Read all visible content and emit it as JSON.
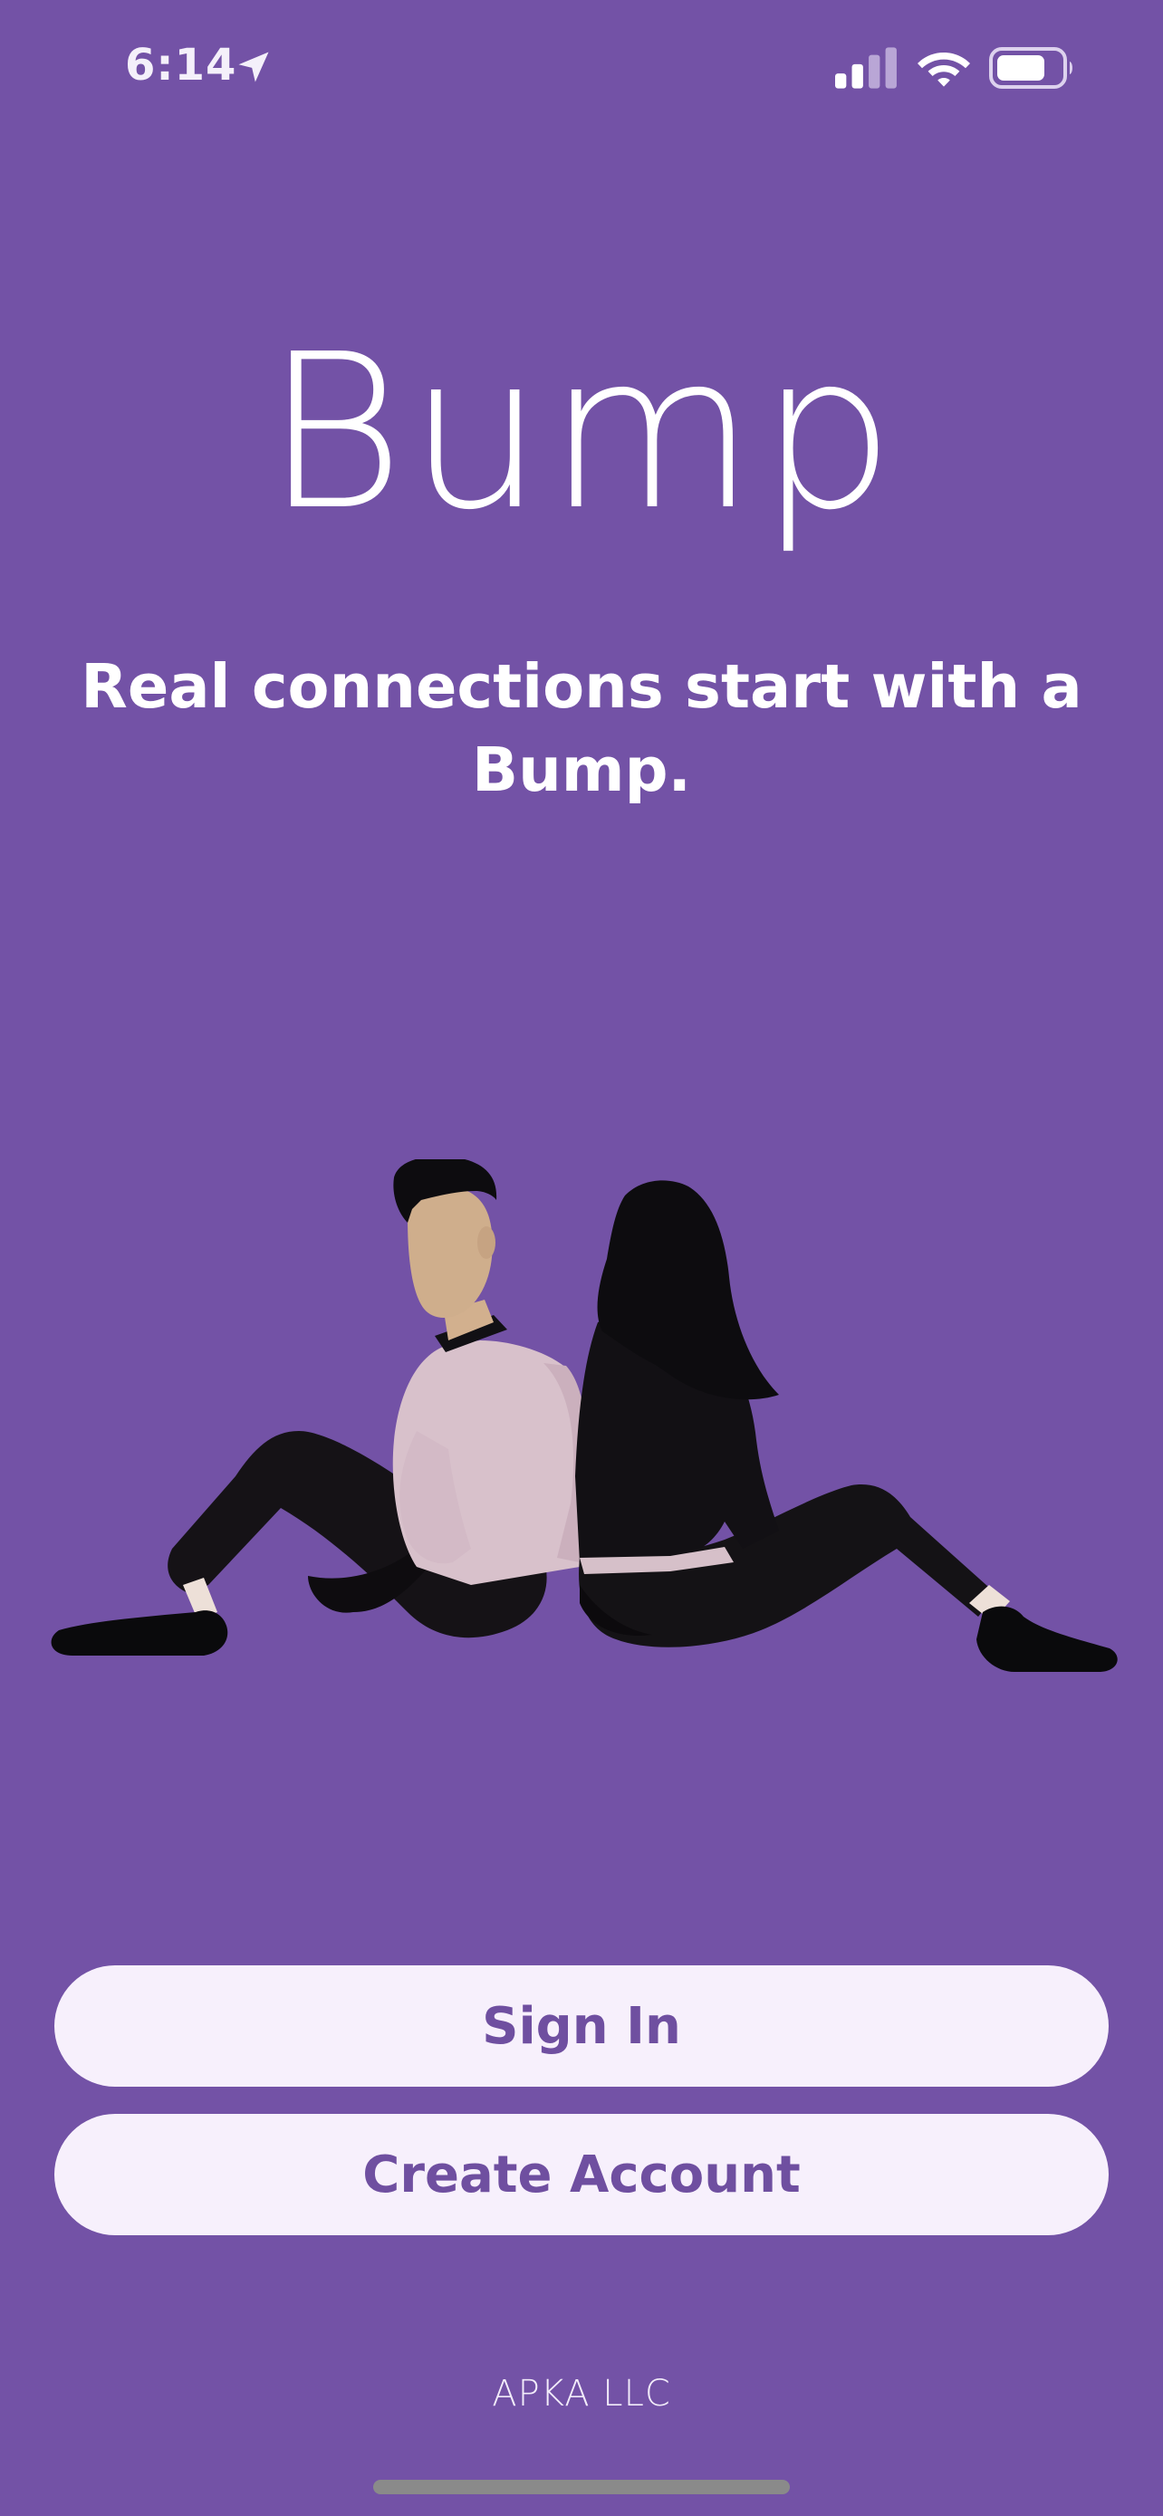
{
  "status_bar": {
    "time": "6:14",
    "icons": [
      "location-arrow-icon",
      "cellular-signal-icon",
      "wifi-icon",
      "battery-icon"
    ]
  },
  "app": {
    "title": "Bump",
    "tagline": "Real connections start with a Bump."
  },
  "actions": {
    "sign_in_label": "Sign In",
    "create_account_label": "Create Account"
  },
  "footer": {
    "company": "APKA LLC"
  },
  "colors": {
    "background": "#7352a6",
    "button_bg": "#f7f0fc",
    "button_text": "#6f4fa0",
    "text": "#ffffff"
  }
}
